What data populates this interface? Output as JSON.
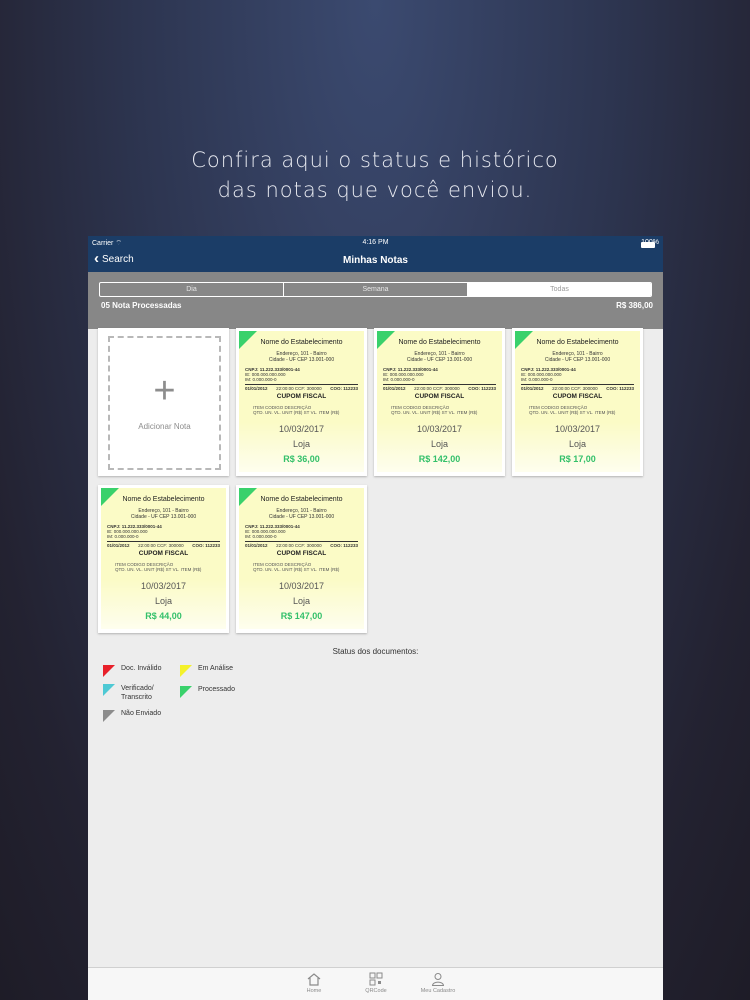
{
  "headline": {
    "line1": "Confira aqui o status e histórico",
    "line2": "das notas que você enviou."
  },
  "status_bar": {
    "carrier": "Carrier",
    "time": "4:16 PM",
    "battery": "100%"
  },
  "nav": {
    "back_label": "Search",
    "title": "Minhas Notas"
  },
  "filter": {
    "tabs": [
      {
        "label": "Dia"
      },
      {
        "label": "Semana"
      },
      {
        "label": "Todas"
      }
    ],
    "selected": "Todas",
    "count_label": "05 Nota Processadas",
    "total": "R$ 386,00"
  },
  "add_card": {
    "label": "Adicionar Nota"
  },
  "receipt_template": {
    "name": "Nome do Estabelecimento",
    "address1": "Endereço, 101 - Bairro",
    "address2": "Cidade - UF CEP 13.001-000",
    "cnpj": "CNPJ: 11.222.333/0001-44",
    "ie": "IE: 000.000.000.000",
    "im": "IM: 0.000.000-0",
    "line_left": "01/01/2012",
    "line_mid": "22:00:00 CCF: 300000",
    "line_right": "COO: 112233",
    "doc_title": "CUPOM FISCAL",
    "cols1": "ITEM CODIGO     DESCRIÇÃO",
    "cols2": "QTD.    UN.    VL. UNIT (R$) ST    VL. ITEM (R$)"
  },
  "notes": [
    {
      "date": "10/03/2017",
      "store": "Loja",
      "value": "R$ 36,00",
      "status": "Processado"
    },
    {
      "date": "10/03/2017",
      "store": "Loja",
      "value": "R$ 142,00",
      "status": "Processado"
    },
    {
      "date": "10/03/2017",
      "store": "Loja",
      "value": "R$ 17,00",
      "status": "Processado"
    },
    {
      "date": "10/03/2017",
      "store": "Loja",
      "value": "R$ 44,00",
      "status": "Processado"
    },
    {
      "date": "10/03/2017",
      "store": "Loja",
      "value": "R$ 147,00",
      "status": "Processado"
    }
  ],
  "legend": {
    "title": "Status dos documentos:",
    "items": [
      {
        "label": "Doc. Inválido",
        "color": "#e8202a"
      },
      {
        "label": "Em Análise",
        "color": "#f4f12a"
      },
      {
        "label": "Verificado/\nTranscrito",
        "color": "#4ec9d4"
      },
      {
        "label": "Processado",
        "color": "#39d16b"
      },
      {
        "label": "Não Enviado",
        "color": "#8c8c8c"
      }
    ]
  },
  "tabbar": {
    "items": [
      {
        "label": "Home",
        "icon": "home-icon"
      },
      {
        "label": "QRCode",
        "icon": "qrcode-icon"
      },
      {
        "label": "Meu Cadastro",
        "icon": "person-icon"
      }
    ]
  },
  "colors": {
    "nav_bg": "#1b3d67",
    "filter_bg": "#878787",
    "receipt_bg": "#fbfbc6",
    "value_green": "#33c06a"
  }
}
